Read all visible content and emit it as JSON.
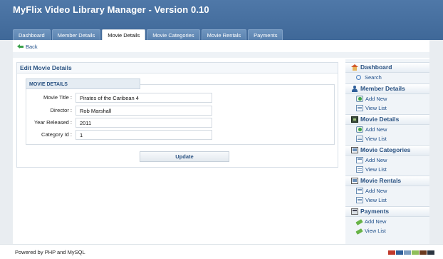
{
  "app_title": "MyFlix Video Library Manager - Version 0.10",
  "tabs": [
    {
      "label": "Dashboard"
    },
    {
      "label": "Member Details"
    },
    {
      "label": "Movie Details"
    },
    {
      "label": "Movie Categories"
    },
    {
      "label": "Movie Rentals"
    },
    {
      "label": "Payments"
    }
  ],
  "active_tab": "Movie Details",
  "back_label": "Back",
  "form": {
    "panel_title": "Edit Movie Details",
    "legend": "MOVIE DETAILS",
    "fields": [
      {
        "label": "Movie Title :",
        "value": "Pirates of the Caribean 4"
      },
      {
        "label": "Director :",
        "value": "Rob Marshall"
      },
      {
        "label": "Year Released :",
        "value": "2011"
      },
      {
        "label": "Category Id :",
        "value": "1"
      }
    ],
    "update_label": "Update"
  },
  "sidebar": {
    "sections": [
      {
        "title": "Dashboard",
        "icon": "home-icon",
        "items": [
          {
            "label": "Search",
            "icon": "search-icon"
          }
        ]
      },
      {
        "title": "Member Details",
        "icon": "user-icon",
        "items": [
          {
            "label": "Add New",
            "icon": "add-icon"
          },
          {
            "label": "View List",
            "icon": "list-icon"
          }
        ]
      },
      {
        "title": "Movie Details",
        "icon": "film-icon",
        "items": [
          {
            "label": "Add New",
            "icon": "add-icon"
          },
          {
            "label": "View List",
            "icon": "list-icon"
          }
        ]
      },
      {
        "title": "Movie Categories",
        "icon": "monitor-icon",
        "items": [
          {
            "label": "Add New",
            "icon": "add-window-icon"
          },
          {
            "label": "View List",
            "icon": "list-icon"
          }
        ]
      },
      {
        "title": "Movie Rentals",
        "icon": "monitor-icon",
        "items": [
          {
            "label": "Add New",
            "icon": "add-window-icon"
          },
          {
            "label": "View List",
            "icon": "list-icon"
          }
        ]
      },
      {
        "title": "Payments",
        "icon": "calculator-icon",
        "items": [
          {
            "label": "Add New",
            "icon": "payment-icon"
          },
          {
            "label": "View List",
            "icon": "payment-icon"
          }
        ]
      }
    ]
  },
  "footer_text": "Powered by PHP and MySQL",
  "theme_swatches": [
    "#c0392b",
    "#2e5f9a",
    "#7a9cc0",
    "#8fbf5a",
    "#6b3a1e",
    "#2b3540"
  ]
}
